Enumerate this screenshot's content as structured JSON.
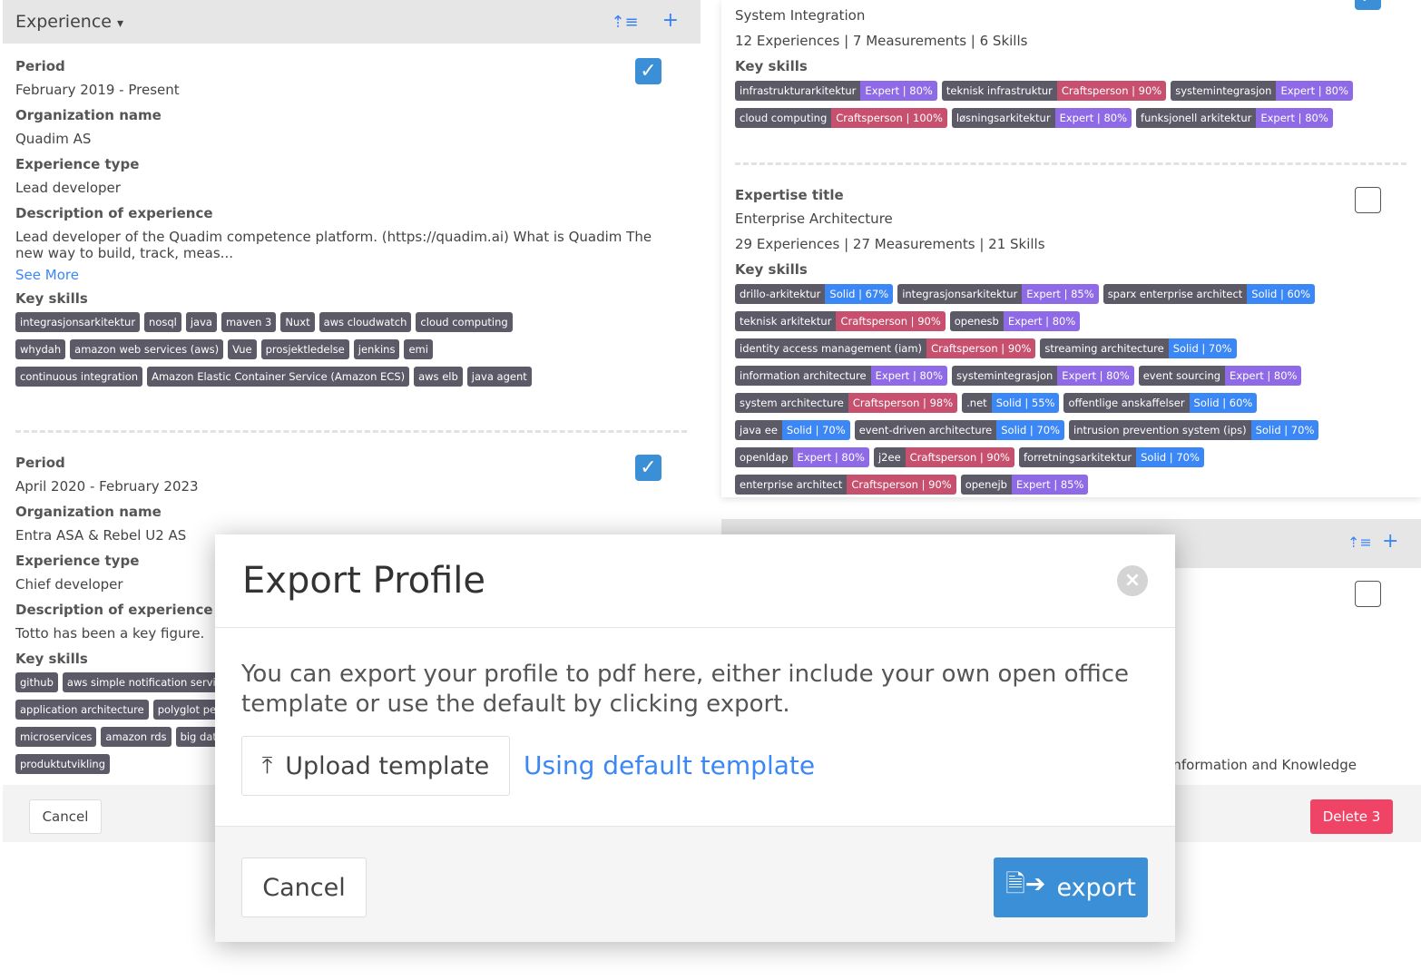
{
  "left": {
    "header": {
      "title": "Experience",
      "caret": "▾",
      "sort_icon": "sort-icon",
      "add_icon": "plus-icon"
    },
    "experiences": [
      {
        "period_label": "Period",
        "period": "February 2019 - Present",
        "org_label": "Organization name",
        "org": "Quadim AS",
        "type_label": "Experience type",
        "type": "Lead developer",
        "desc_label": "Description of experience",
        "desc": "Lead developer of the Quadim competence platform. (https://quadim.ai) What is Quadim The new way to build, track, meas...",
        "see_more": "See More",
        "skills_label": "Key skills",
        "checked": true,
        "skills": [
          "integrasjonsarkitektur",
          "nosql",
          "java",
          "maven 3",
          "Nuxt",
          "aws cloudwatch",
          "cloud computing",
          "whydah",
          "amazon web services (aws)",
          "Vue",
          "prosjektledelse",
          "jenkins",
          "emi",
          "continuous integration",
          "Amazon Elastic Container Service (Amazon ECS)",
          "aws elb",
          "java agent"
        ]
      },
      {
        "period_label": "Period",
        "period": "April 2020 - February 2023",
        "org_label": "Organization name",
        "org": "Entra ASA & Rebel U2 AS",
        "type_label": "Experience type",
        "type": "Chief developer",
        "desc_label": "Description of experience",
        "desc": "Totto has been a key figure.",
        "skills_label": "Key skills",
        "checked": true,
        "skills": [
          "github",
          "aws simple notification service",
          "application architecture",
          "polyglot persistence",
          "microservices",
          "amazon rds",
          "big data",
          "produktutvikling"
        ]
      }
    ]
  },
  "right": {
    "expertise": [
      {
        "title": "System Integration",
        "stats": "12 Experiences | 7 Measurements | 6 Skills",
        "skills_label": "Key skills",
        "checked": true,
        "skills": [
          {
            "name": "infrastrukturarkitektur",
            "level": "Expert",
            "pct": "80%"
          },
          {
            "name": "teknisk infrastruktur",
            "level": "Craftsperson",
            "pct": "90%"
          },
          {
            "name": "systemintegrasjon",
            "level": "Expert",
            "pct": "80%"
          },
          {
            "name": "cloud computing",
            "level": "Craftsperson",
            "pct": "100%"
          },
          {
            "name": "løsningsarkitektur",
            "level": "Expert",
            "pct": "80%"
          },
          {
            "name": "funksjonell arkitektur",
            "level": "Expert",
            "pct": "80%"
          }
        ]
      },
      {
        "title_label": "Expertise title",
        "title": "Enterprise Architecture",
        "stats": "29 Experiences | 27 Measurements | 21 Skills",
        "skills_label": "Key skills",
        "checked": false,
        "skills": [
          {
            "name": "drillo-arkitektur",
            "level": "Solid",
            "pct": "67%"
          },
          {
            "name": "integrasjonsarkitektur",
            "level": "Expert",
            "pct": "85%"
          },
          {
            "name": "sparx enterprise architect",
            "level": "Solid",
            "pct": "60%"
          },
          {
            "name": "teknisk arkitektur",
            "level": "Craftsperson",
            "pct": "90%"
          },
          {
            "name": "openesb",
            "level": "Expert",
            "pct": "80%"
          },
          {
            "name": "identity access management (iam)",
            "level": "Craftsperson",
            "pct": "90%"
          },
          {
            "name": "streaming architecture",
            "level": "Solid",
            "pct": "70%"
          },
          {
            "name": "information architecture",
            "level": "Expert",
            "pct": "80%"
          },
          {
            "name": "systemintegrasjon",
            "level": "Expert",
            "pct": "80%"
          },
          {
            "name": "event sourcing",
            "level": "Expert",
            "pct": "80%"
          },
          {
            "name": "system architecture",
            "level": "Craftsperson",
            "pct": "98%"
          },
          {
            "name": ".net",
            "level": "Solid",
            "pct": "55%"
          },
          {
            "name": "offentlige anskaffelser",
            "level": "Solid",
            "pct": "60%"
          },
          {
            "name": "java ee",
            "level": "Solid",
            "pct": "70%"
          },
          {
            "name": "event-driven architecture",
            "level": "Solid",
            "pct": "70%"
          },
          {
            "name": "intrusion prevention system (ips)",
            "level": "Solid",
            "pct": "70%"
          },
          {
            "name": "openldap",
            "level": "Expert",
            "pct": "80%"
          },
          {
            "name": "j2ee",
            "level": "Craftsperson",
            "pct": "90%"
          },
          {
            "name": "forretningsarkitektur",
            "level": "Solid",
            "pct": "70%"
          },
          {
            "name": "enterprise architect",
            "level": "Craftsperson",
            "pct": "90%"
          },
          {
            "name": "openejb",
            "level": "Expert",
            "pct": "85%"
          }
        ]
      }
    ],
    "second_panel_partial_text": "nformation and Knowledge"
  },
  "footer": {
    "cancel": "Cancel",
    "delete": "Delete 3"
  },
  "modal": {
    "title": "Export Profile",
    "body": "You can export your profile to pdf here, either include your own open office template or use the default by clicking export.",
    "upload_label": "Upload template",
    "default_template": "Using default template",
    "cancel": "Cancel",
    "export": "export"
  },
  "colors": {
    "expert": "#8f6ae6",
    "craftsperson": "#c8506f",
    "solid": "#3b87f5",
    "skill": "#5d5a68",
    "primary": "#3b8fd6",
    "delete": "#f04466"
  }
}
